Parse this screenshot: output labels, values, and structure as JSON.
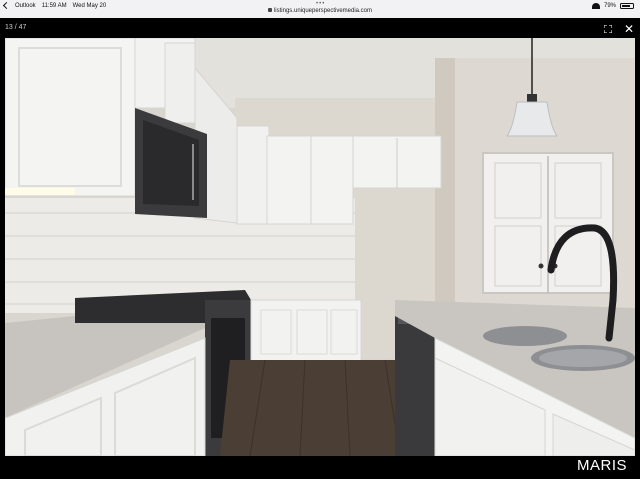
{
  "status_bar": {
    "back_app": "Outlook",
    "time": "11:59 AM",
    "date": "Wed May 20",
    "url": "listings.uniqueperspectivemedia.com",
    "battery": "79%",
    "battery_level": 0.79
  },
  "viewer": {
    "counter": "13 / 47",
    "watermark": "MARIS"
  },
  "colors": {
    "cabinet": "#f3f3f2",
    "granite": "#c9c6c1",
    "floor": "#4a3e35",
    "wall": "#d8d3c9",
    "appliance": "#3c3c3e"
  }
}
